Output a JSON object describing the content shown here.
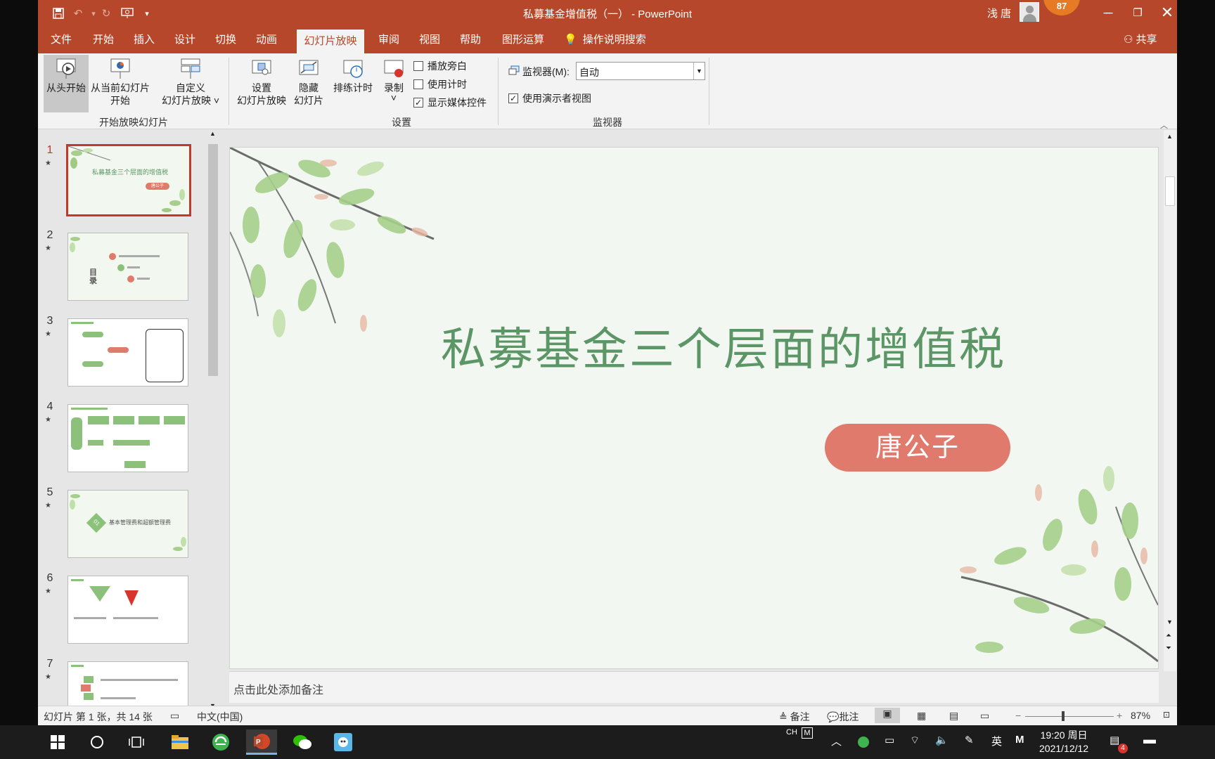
{
  "window": {
    "title": "私募基金增值税（一） - PowerPoint",
    "user_name": "浅 唐",
    "badge_count": "87"
  },
  "tabs": [
    "文件",
    "开始",
    "插入",
    "设计",
    "切换",
    "动画",
    "幻灯片放映",
    "审阅",
    "视图",
    "帮助",
    "图形运算"
  ],
  "active_tab": "幻灯片放映",
  "search_label": "操作说明搜索",
  "share_label": "共享",
  "ribbon": {
    "from_beginning": "从头开始",
    "from_current_1": "从当前幻灯片",
    "from_current_2": "开始",
    "custom_1": "自定义",
    "custom_2": "幻灯片放映 ˅",
    "group_start": "开始放映幻灯片",
    "setup_1": "设置",
    "setup_2": "幻灯片放映",
    "hide_1": "隐藏",
    "hide_2": "幻灯片",
    "rehearse": "排练计时",
    "record": "录制",
    "record_more": "˅",
    "play_narration": "播放旁白",
    "use_timings": "使用计时",
    "show_media": "显示媒体控件",
    "group_setup": "设置",
    "monitor_label": "监视器(M):",
    "monitor_value": "自动",
    "presenter_view": "使用演示者视图",
    "group_monitor": "监视器"
  },
  "checkbox_states": {
    "play_narration": false,
    "use_timings": false,
    "show_media": true,
    "presenter_view": true
  },
  "thumbnails": [
    {
      "num": "1",
      "text": "私募基金三个层面的增值税",
      "tag": "唐公子"
    },
    {
      "num": "2",
      "text": "目录"
    },
    {
      "num": "3",
      "text": ""
    },
    {
      "num": "4",
      "text": ""
    },
    {
      "num": "5",
      "text": "基本管理费和超额管理费",
      "tag": "01"
    },
    {
      "num": "6",
      "text": ""
    },
    {
      "num": "7",
      "text": ""
    }
  ],
  "slide": {
    "title": "私募基金三个层面的增值税",
    "author": "唐公子"
  },
  "notes_placeholder": "点击此处添加备注",
  "status": {
    "slide_info": "幻灯片 第 1 张，共 14 张",
    "language": "中文(中国)",
    "notes": "备注",
    "comments": "批注",
    "zoom": "87%"
  },
  "taskbar": {
    "ime_ch": "CH",
    "ime_lang": "英",
    "ime_m": "M",
    "time": "19:20 周日",
    "date": "2021/12/12",
    "notif_count": "4"
  },
  "colors": {
    "accent": "#b7472a",
    "slide_title": "#5c9666",
    "author_pill": "#e07a6c",
    "slide_bg": "#f2f8f1"
  }
}
